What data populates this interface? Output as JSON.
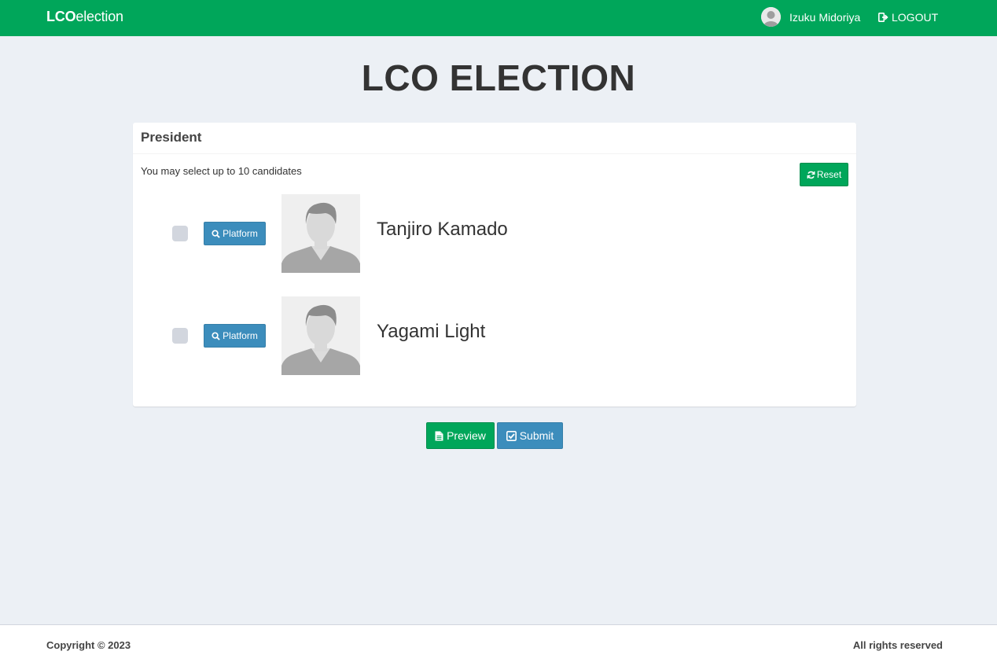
{
  "navbar": {
    "brand_bold": "LCO",
    "brand_rest": "election",
    "user_name": "Izuku Midoriya",
    "logout_label": "LOGOUT"
  },
  "page_title": "LCO ELECTION",
  "ballot": {
    "position_title": "President",
    "instruction": "You may select up to 10 candidates",
    "reset_label": "Reset",
    "platform_label": "Platform",
    "candidates": [
      {
        "name": "Tanjiro Kamado",
        "checked": false
      },
      {
        "name": "Yagami Light",
        "checked": false
      }
    ]
  },
  "actions": {
    "preview_label": "Preview",
    "submit_label": "Submit"
  },
  "footer": {
    "copyright": "Copyright © 2023",
    "rights": "All rights reserved"
  },
  "colors": {
    "brand_green": "#00a65a",
    "button_blue": "#3c8dbc",
    "page_background": "#ecf0f5"
  }
}
